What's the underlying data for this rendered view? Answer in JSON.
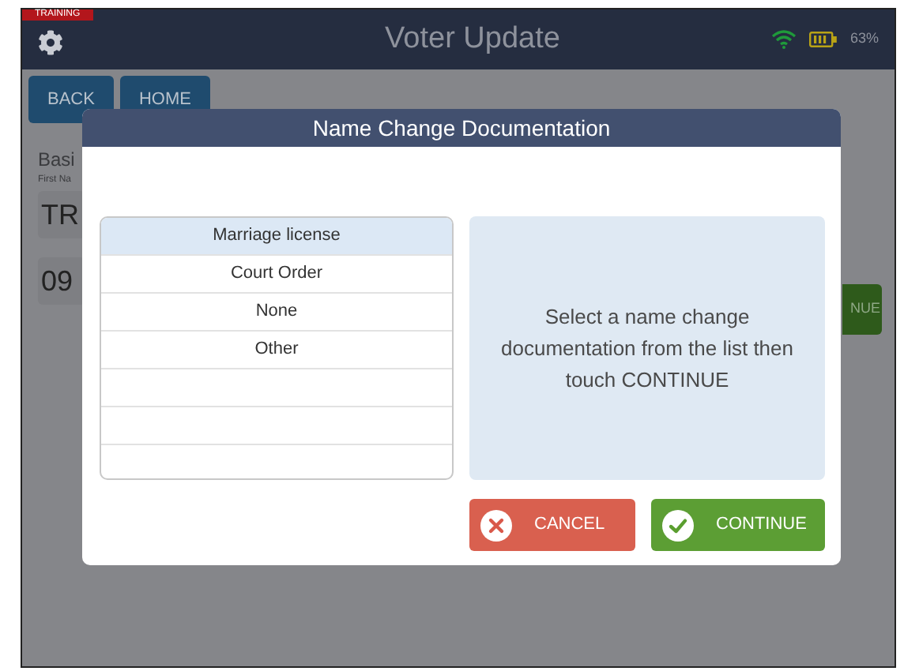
{
  "header": {
    "badge": "TRAINING",
    "title": "Voter Update",
    "battery_percent": "63%"
  },
  "nav_buttons": [
    "BACK",
    "HOME"
  ],
  "background_form": {
    "section": "Basi",
    "field_label": "First Na",
    "field_1_value": "TR",
    "field_2_value": "09",
    "side_button": "NUE"
  },
  "dialog": {
    "title": "Name Change Documentation",
    "options": [
      {
        "label": "Marriage license",
        "selected": true
      },
      {
        "label": "Court Order",
        "selected": false
      },
      {
        "label": "None",
        "selected": false
      },
      {
        "label": "Other",
        "selected": false
      }
    ],
    "instructions": "Select a name change documentation from the list then touch CONTINUE",
    "buttons": [
      {
        "kind": "cancel",
        "label": "CANCEL"
      },
      {
        "kind": "continue",
        "label": "CONTINUE"
      }
    ]
  }
}
